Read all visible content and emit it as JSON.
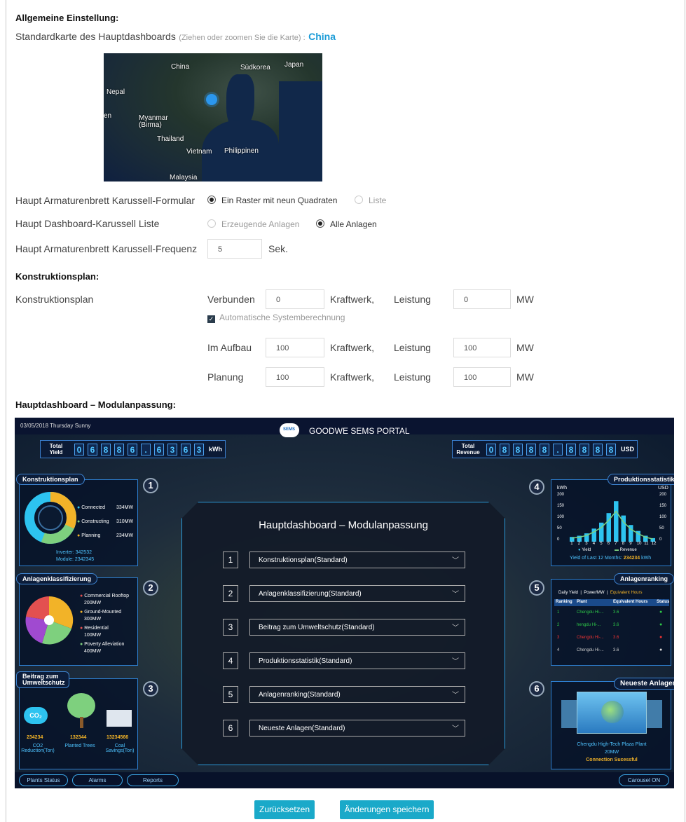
{
  "general": {
    "heading": "Allgemeine Einstellung:",
    "map_label": "Standardkarte des Hauptdashboards",
    "map_hint": "(Ziehen oder zoomen Sie die Karte) :",
    "map_region": "China",
    "map_labels": [
      "China",
      "Südkorea",
      "Japan",
      "Nepal",
      "Myanmar (Birma)",
      "Thailand",
      "Vietnam",
      "Philippinen",
      "Malaysia",
      "en"
    ]
  },
  "carousel": {
    "form_label": "Haupt Armaturenbrett Karussell-Formular",
    "form_options": [
      "Ein Raster mit neun Quadraten",
      "Liste"
    ],
    "form_selected": 0,
    "list_label": "Haupt Dashboard-Karussell Liste",
    "list_options": [
      "Erzeugende Anlagen",
      "Alle Anlagen"
    ],
    "list_selected": 1,
    "freq_label": "Haupt Armaturenbrett Karussell-Frequenz",
    "freq_value": "5",
    "freq_unit": "Sek."
  },
  "plan": {
    "heading": "Konstruktionsplan:",
    "label": "Konstruktionsplan",
    "kraftwerk": "Kraftwerk,",
    "leistung": "Leistung",
    "mw": "MW",
    "auto_calc": "Automatische Systemberechnung",
    "rows": [
      {
        "label": "Verbunden",
        "count": "0",
        "power": "0"
      },
      {
        "label": "Im Aufbau",
        "count": "100",
        "power": "100"
      },
      {
        "label": "Planung",
        "count": "100",
        "power": "100"
      }
    ]
  },
  "dashboard": {
    "heading": "Hauptdashboard – Modulanpassung:",
    "date": "03/05/2018   Thursday   Sunny",
    "brand": "GOODWE SEMS PORTAL",
    "cloud": "SEMS",
    "total_yield_label": "Total Yield",
    "total_yield_digits": [
      "0",
      "6",
      "8",
      "8",
      "6",
      ".",
      "6",
      "3",
      "6",
      "3"
    ],
    "total_yield_unit": "kWh",
    "total_revenue_label": "Total Revenue",
    "total_revenue_digits": [
      "0",
      "8",
      "8",
      "8",
      "8",
      ".",
      "8",
      "8",
      "8",
      "8"
    ],
    "total_revenue_unit": "USD",
    "panels": {
      "p1": {
        "title": "Konstruktionsplan",
        "num": "1",
        "items": [
          {
            "k": "Connected",
            "v": "334MW"
          },
          {
            "k": "Constructing",
            "v": "310MW"
          },
          {
            "k": "Planning",
            "v": "234MW"
          }
        ],
        "inverter": "Inverter: 342532",
        "module": "Module: 2342345"
      },
      "p2": {
        "title": "Anlagenklassifizierung",
        "num": "2",
        "items": [
          {
            "k": "Commercial Rooftop",
            "v": "200MW"
          },
          {
            "k": "Ground-Mounted",
            "v": "300MW"
          },
          {
            "k": "Residential",
            "v": "100MW"
          },
          {
            "k": "Poverty Alleviation",
            "v": "400MW"
          }
        ]
      },
      "p3": {
        "title": "Beitrag zum Umweltschutz",
        "num": "3",
        "co2": "CO₂",
        "items": [
          {
            "v": "234234",
            "k": "CO2 Reduction(Ton)"
          },
          {
            "v": "132344",
            "k": "Planted Trees"
          },
          {
            "v": "13234566",
            "k": "Coal Savings(Ton)"
          }
        ]
      },
      "p4": {
        "title": "Produktionsstatistik",
        "num": "4",
        "kwh": "kWh",
        "usd": "USD",
        "axis_left": [
          "200",
          "150",
          "100",
          "50",
          "0"
        ],
        "axis_right": [
          "200",
          "150",
          "100",
          "50",
          "0"
        ],
        "months": [
          "1",
          "2",
          "3",
          "4",
          "5",
          "6",
          "7",
          "8",
          "9",
          "10",
          "11",
          "12"
        ],
        "legend_yield": "Yield",
        "legend_revenue": "Revenue",
        "footer": "Yield of Last 12 Months:",
        "footer_value": "234234",
        "footer_unit": "kWh"
      },
      "p5": {
        "title": "Anlagenranking",
        "num": "5",
        "tabs": [
          "Daily Yield",
          "Power/MW",
          "Equivalent Hours"
        ],
        "cols": [
          "Ranking",
          "Plant",
          "Equivalent Hours",
          "Status"
        ],
        "rows": [
          {
            "r": "1",
            "p": "Chengdu Hi-...",
            "h": "3.6"
          },
          {
            "r": "2",
            "p": "hengdu Hi-...",
            "h": "3.6"
          },
          {
            "r": "3",
            "p": "Chengdu Hi-...",
            "h": "3.6"
          },
          {
            "r": "4",
            "p": "Chengdu Hi-...",
            "h": "3.6"
          }
        ]
      },
      "p6": {
        "title": "Neueste Anlagen",
        "num": "6",
        "plant": "Chengdu High-Tech Plaza Plant",
        "power": "20MW",
        "status": "Connection Sucessful"
      }
    },
    "modal": {
      "title": "Hauptdashboard – Modulanpassung",
      "rows": [
        {
          "n": "1",
          "v": "Konstruktionsplan(Standard)"
        },
        {
          "n": "2",
          "v": "Anlagenklassifizierung(Standard)"
        },
        {
          "n": "3",
          "v": "Beitrag zum Umweltschutz(Standard)"
        },
        {
          "n": "4",
          "v": "Produktionsstatistik(Standard)"
        },
        {
          "n": "5",
          "v": "Anlagenranking(Standard)"
        },
        {
          "n": "6",
          "v": "Neueste Anlagen(Standard)"
        }
      ]
    },
    "bottom": {
      "plants": "Plants Status",
      "alarms": "Alarms",
      "reports": "Reports",
      "carousel": "Carousel ON"
    },
    "chart_data": {
      "type": "bar",
      "categories": [
        "1",
        "2",
        "3",
        "4",
        "5",
        "6",
        "7",
        "8",
        "9",
        "10",
        "11",
        "12"
      ],
      "values": [
        20,
        25,
        35,
        55,
        80,
        120,
        170,
        110,
        70,
        45,
        25,
        15
      ],
      "ylim": [
        0,
        200
      ]
    }
  },
  "buttons": {
    "reset": "Zurücksetzen",
    "save": "Änderungen speichern"
  },
  "colors": {
    "accent": "#1aa9c9",
    "link": "#1a9bd7",
    "panel_border": "#2d7fd0"
  }
}
